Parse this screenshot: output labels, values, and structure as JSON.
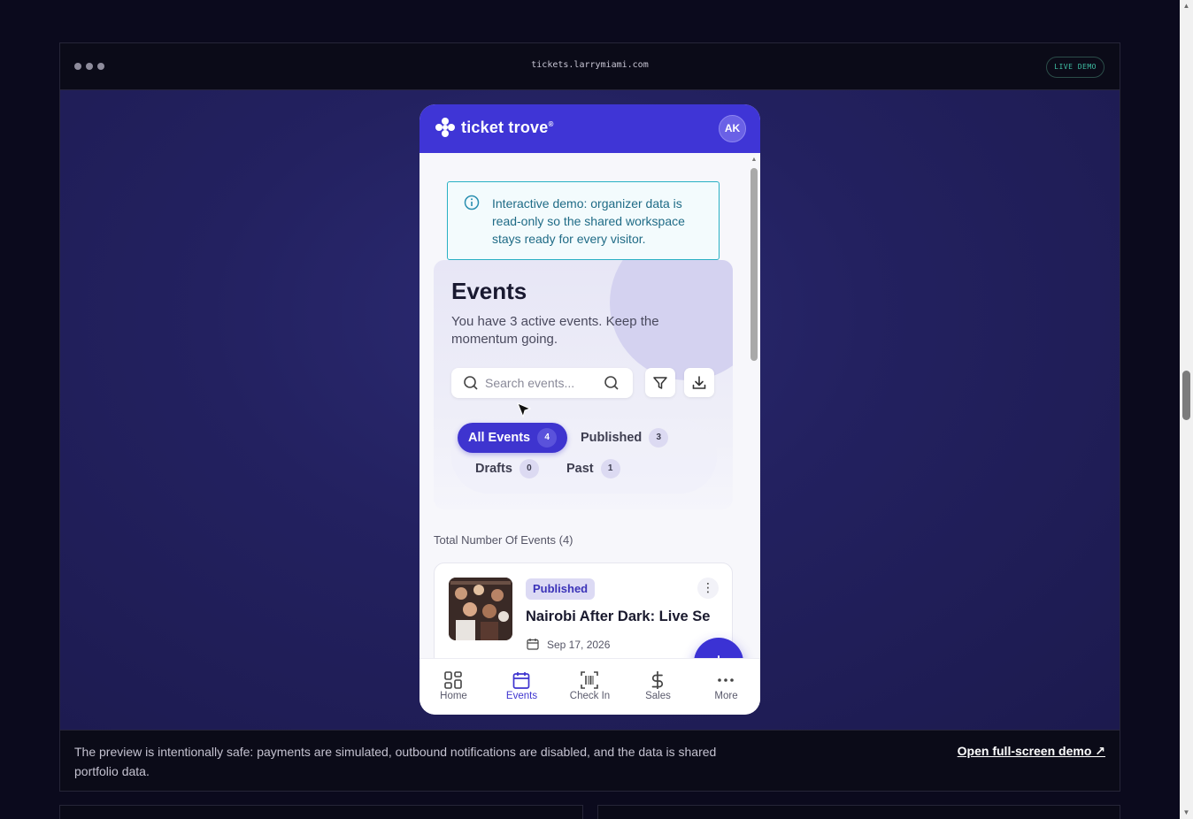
{
  "browser": {
    "url": "tickets.larrymiami.com",
    "badge": "LIVE DEMO",
    "footer_note": "The preview is intentionally safe: payments are simulated, outbound notifications are disabled, and the data is shared portfolio data.",
    "open_link": "Open full-screen demo ↗"
  },
  "app": {
    "brand": "ticket trove",
    "brand_mark": "®",
    "avatar_initials": "AK",
    "primary_color": "#3f35d6",
    "info_notice": "Interactive demo: organizer data is read-only so the shared workspace stays ready for every visitor.",
    "hero": {
      "title": "Events",
      "subtitle": "You have 3 active events. Keep the momentum going."
    },
    "search": {
      "placeholder": "Search events..."
    },
    "tabs": [
      {
        "label": "All Events",
        "count": "4",
        "active": true
      },
      {
        "label": "Published",
        "count": "3",
        "active": false
      },
      {
        "label": "Drafts",
        "count": "0",
        "active": false
      },
      {
        "label": "Past",
        "count": "1",
        "active": false
      }
    ],
    "total_label": "Total Number Of Events (4)",
    "events": [
      {
        "status": "Published",
        "title": "Nairobi After Dark: Live Se",
        "date": "Sep 17, 2026"
      }
    ],
    "bottom_nav": [
      {
        "label": "Home",
        "icon": "grid-icon",
        "active": false
      },
      {
        "label": "Events",
        "icon": "calendar-icon",
        "active": true
      },
      {
        "label": "Check In",
        "icon": "barcode-scan-icon",
        "active": false
      },
      {
        "label": "Sales",
        "icon": "dollar-icon",
        "active": false
      },
      {
        "label": "More",
        "icon": "more-dots-icon",
        "active": false
      }
    ]
  }
}
